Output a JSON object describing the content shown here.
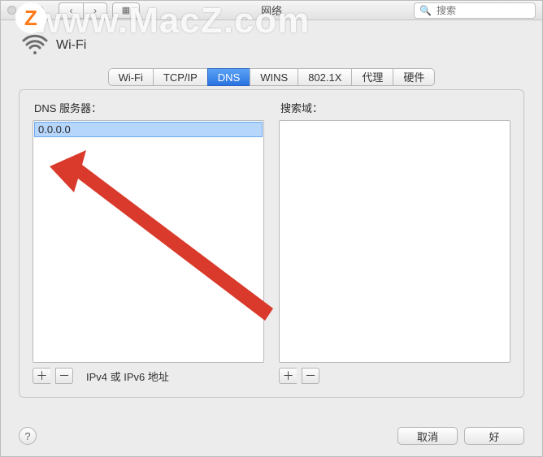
{
  "window": {
    "title": "网络"
  },
  "search": {
    "placeholder": "搜索"
  },
  "header": {
    "interface_name": "Wi-Fi"
  },
  "tabs": [
    {
      "label": "Wi-Fi",
      "active": false
    },
    {
      "label": "TCP/IP",
      "active": false
    },
    {
      "label": "DNS",
      "active": true
    },
    {
      "label": "WINS",
      "active": false
    },
    {
      "label": "802.1X",
      "active": false
    },
    {
      "label": "代理",
      "active": false
    },
    {
      "label": "硬件",
      "active": false
    }
  ],
  "dns": {
    "servers_label": "DNS 服务器：",
    "servers": [
      "0.0.0.0"
    ],
    "selected_index": 0,
    "hint": "IPv4 或 IPv6 地址"
  },
  "search_domains": {
    "label": "搜索域：",
    "items": []
  },
  "buttons": {
    "add": "＋",
    "remove": "－",
    "help": "?",
    "cancel": "取消",
    "ok": "好"
  },
  "watermark": {
    "text": "www.MacZ.com",
    "badge": "Z"
  }
}
